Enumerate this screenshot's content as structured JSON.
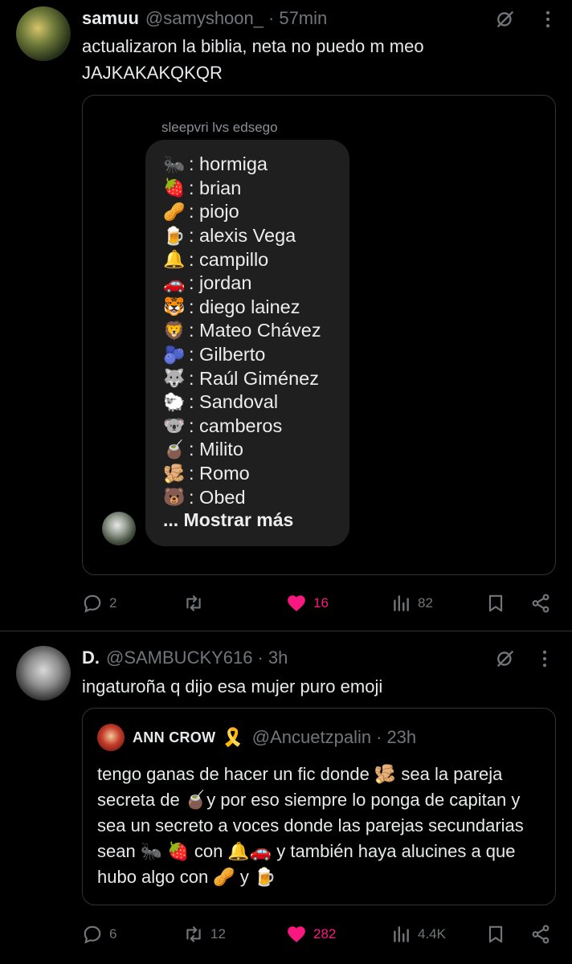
{
  "colors": {
    "background": "#000000",
    "text_primary": "#e7e9ea",
    "text_secondary": "#71767b",
    "border": "#2f3336",
    "like_active": "#f91880",
    "bubble": "#1f1f1f"
  },
  "posts": [
    {
      "author_name": "samuu",
      "handle": "@samyshoon_",
      "separator": "·",
      "time": "57min",
      "text_line1": "actualizaron la biblia, neta no puedo m meo",
      "text_line2": "JAJKAKAKQKQR",
      "media": {
        "sender": "sleepvri lvs edsego",
        "items": [
          {
            "emoji": "🐜",
            "label": ": hormiga"
          },
          {
            "emoji": "🍓",
            "label": ": brian"
          },
          {
            "emoji": "🥜",
            "label": ": piojo"
          },
          {
            "emoji": "🍺",
            "label": ": alexis Vega"
          },
          {
            "emoji": "🔔",
            "label": ": campillo"
          },
          {
            "emoji": "🚗",
            "label": ": jordan"
          },
          {
            "emoji": "🐯",
            "label": ": diego lainez"
          },
          {
            "emoji": "🦁",
            "label": ": Mateo Chávez"
          },
          {
            "emoji": "🫐",
            "label": ": Gilberto"
          },
          {
            "emoji": "🐺",
            "label": ": Raúl Giménez"
          },
          {
            "emoji": "🐑",
            "label": ": Sandoval"
          },
          {
            "emoji": "🐨",
            "label": ": camberos"
          },
          {
            "emoji": "🧉",
            "label": ": Milito"
          },
          {
            "emoji": "🫚",
            "label": ": Romo"
          },
          {
            "emoji": "🐻",
            "label": ": Obed"
          }
        ],
        "show_more": "... Mostrar más"
      },
      "stats": {
        "replies": "2",
        "reposts": "",
        "likes": "16",
        "views": "82"
      }
    },
    {
      "author_name": "D.",
      "handle": "@SAMBUCKY616",
      "separator": "·",
      "time": "3h",
      "text_line1": "ingaturoña q dijo esa mujer puro emoji",
      "quote": {
        "name": "ANN CROW",
        "ribbon": "🎗️",
        "handle": "@Ancuetzpalin",
        "separator": "·",
        "time": "23h",
        "text": "tengo ganas de hacer un fic donde 🫚 sea la pareja secreta de 🧉y por eso siempre lo ponga de capitan y sea un secreto a voces donde las parejas secundarias sean 🐜 🍓 con 🔔🚗 y también haya alucines a que hubo algo con 🥜 y 🍺"
      },
      "stats": {
        "replies": "6",
        "reposts": "12",
        "likes": "282",
        "views": "4.4K"
      }
    }
  ]
}
